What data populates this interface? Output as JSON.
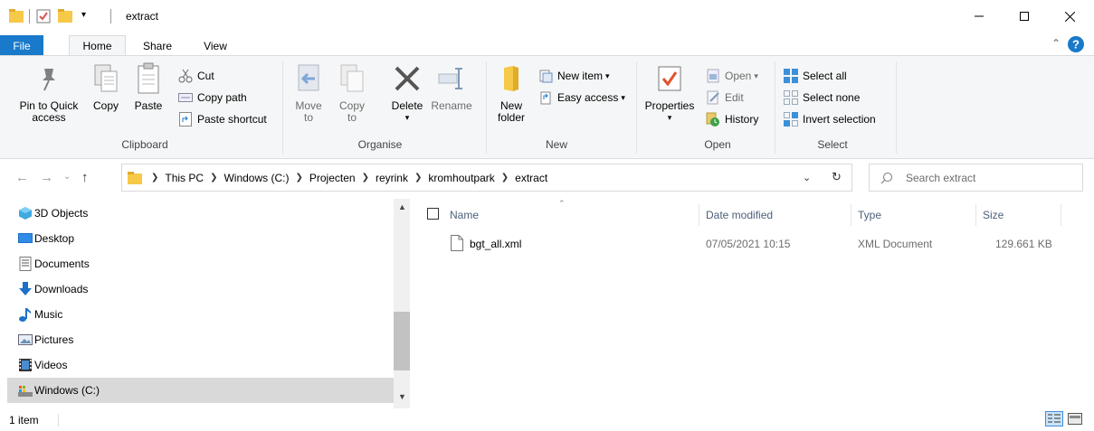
{
  "window": {
    "title": "extract",
    "controls": [
      "minimize-icon",
      "maximize-icon",
      "close-icon"
    ]
  },
  "ribbon_tabs": {
    "file": "File",
    "home": "Home",
    "share": "Share",
    "view": "View"
  },
  "clipboard": {
    "group_label": "Clipboard",
    "pin_line1": "Pin to Quick",
    "pin_line2": "access",
    "copy": "Copy",
    "paste": "Paste",
    "cut": "Cut",
    "copy_path": "Copy path",
    "paste_shortcut": "Paste shortcut"
  },
  "organise": {
    "group_label": "Organise",
    "move_line1": "Move",
    "move_line2": "to",
    "copy_line1": "Copy",
    "copy_line2": "to",
    "delete": "Delete",
    "rename": "Rename"
  },
  "new_group": {
    "group_label": "New",
    "new_folder_line1": "New",
    "new_folder_line2": "folder",
    "new_item": "New item",
    "easy_access": "Easy access"
  },
  "open_group": {
    "group_label": "Open",
    "properties": "Properties",
    "open": "Open",
    "edit": "Edit",
    "history": "History"
  },
  "select_group": {
    "group_label": "Select",
    "select_all": "Select all",
    "select_none": "Select none",
    "invert_selection": "Invert selection"
  },
  "address": {
    "crumbs": [
      "This PC",
      "Windows (C:)",
      "Projecten",
      "reyrink",
      "kromhoutpark",
      "extract"
    ],
    "search_placeholder": "Search extract"
  },
  "nav_pane": {
    "items": [
      "3D Objects",
      "Desktop",
      "Documents",
      "Downloads",
      "Music",
      "Pictures",
      "Videos",
      "Windows (C:)"
    ],
    "selected": "Windows (C:)"
  },
  "file_list": {
    "columns": [
      "Name",
      "Date modified",
      "Type",
      "Size"
    ],
    "rows": [
      {
        "name": "bgt_all.xml",
        "date": "07/05/2021 10:15",
        "type": "XML Document",
        "size": "129.661 KB"
      }
    ]
  },
  "status": {
    "item_count": "1 item"
  },
  "colors": {
    "accent": "#1979ca",
    "selection": "#d9d9d9",
    "ribbon_bg": "#f5f6f7"
  }
}
